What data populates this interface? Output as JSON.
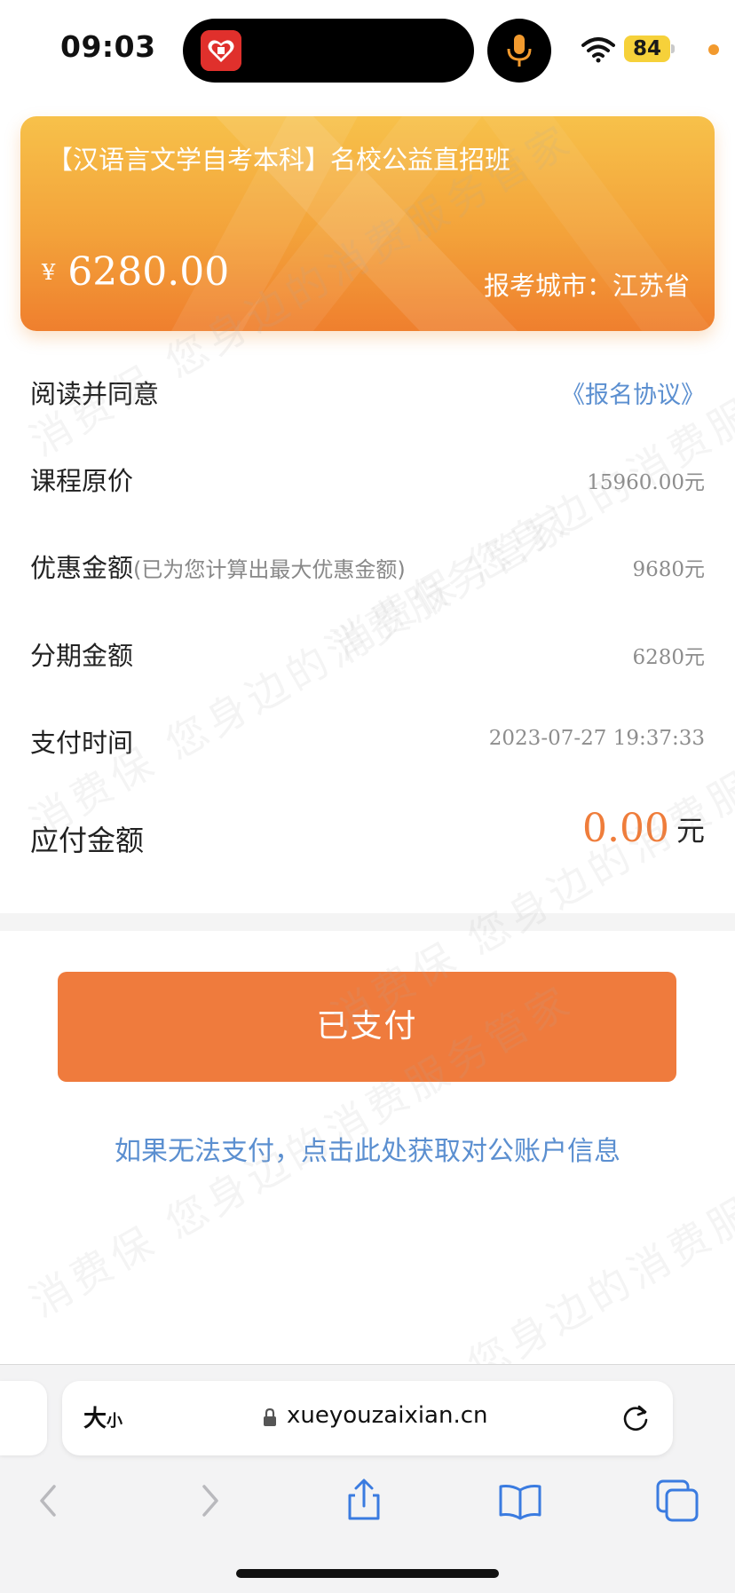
{
  "status_bar": {
    "time": "09:03",
    "battery": "84"
  },
  "course": {
    "title": "【汉语言文学自考本科】名校公益直招班",
    "currency_symbol": "¥",
    "price": "6280.00",
    "city_label": "报考城市：",
    "city": "江苏省"
  },
  "rows": {
    "agreement": {
      "label": "阅读并同意",
      "link": "《报名协议》"
    },
    "original_price": {
      "label": "课程原价",
      "value": "15960.00元"
    },
    "discount": {
      "label": "优惠金额",
      "note": "(已为您计算出最大优惠金额)",
      "value": "9680元"
    },
    "installment": {
      "label": "分期金额",
      "value": "6280元"
    },
    "pay_time": {
      "label": "支付时间",
      "value": "2023-07-27 19:37:33"
    },
    "payable": {
      "label": "应付金额",
      "amount": "0.00",
      "unit": "元"
    }
  },
  "actions": {
    "paid_button": "已支付",
    "bank_info_link": "如果无法支付，点击此处获取对公账户信息"
  },
  "browser": {
    "text_size_big": "大",
    "text_size_small": "小",
    "url": "xueyouzaixian.cn"
  },
  "watermark": {
    "text": "消费保 您身边的消费服务管家"
  },
  "colors": {
    "accent_orange": "#ef7b3d",
    "link_blue": "#5b8fd0",
    "card_gradient_top": "#f7c14a",
    "card_gradient_bottom": "#ef7f2e"
  },
  "icons": [
    "pinduoduo-app-icon",
    "microphone-icon",
    "wifi-icon",
    "battery-icon",
    "lock-icon",
    "reload-icon",
    "back-icon",
    "forward-icon",
    "share-icon",
    "bookmarks-icon",
    "tabs-icon"
  ]
}
